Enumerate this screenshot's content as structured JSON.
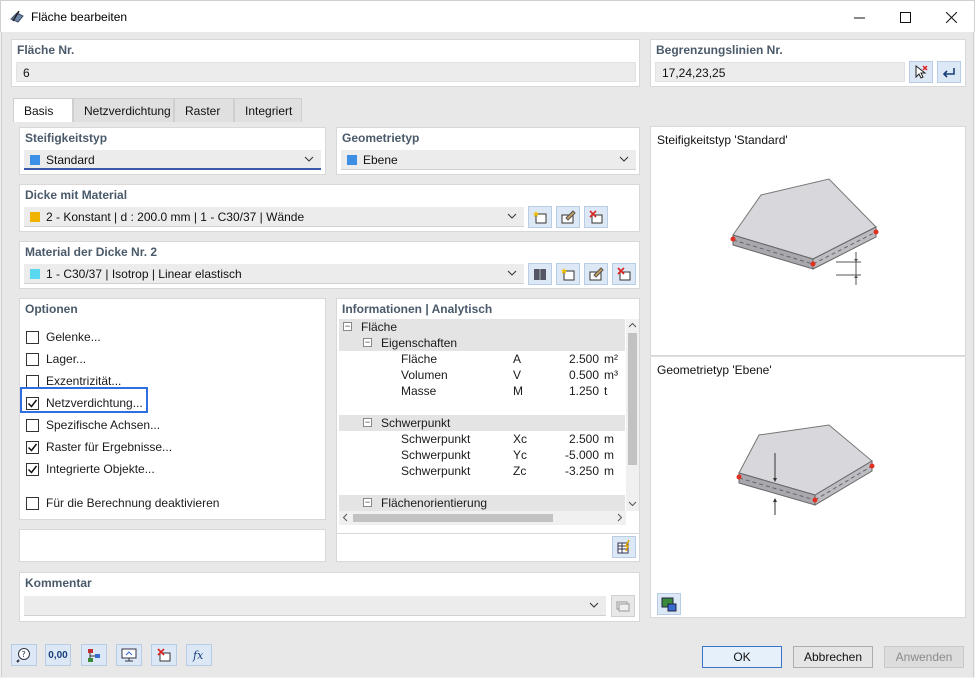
{
  "window": {
    "title": "Fläche bearbeiten"
  },
  "surface_no": {
    "label": "Fläche Nr.",
    "value": "6"
  },
  "boundary_lines": {
    "label": "Begrenzungslinien Nr.",
    "value": "17,24,23,25"
  },
  "tabs": [
    {
      "label": "Basis"
    },
    {
      "label": "Netzverdichtung"
    },
    {
      "label": "Raster"
    },
    {
      "label": "Integriert"
    }
  ],
  "stiffness": {
    "label": "Steifigkeitstyp",
    "value": "Standard",
    "swatch": "#3c8ee6"
  },
  "geometry": {
    "label": "Geometrietyp",
    "value": "Ebene",
    "swatch": "#3c8ee6"
  },
  "thickness": {
    "label": "Dicke mit Material",
    "value": "2 - Konstant | d : 200.0 mm | 1 - C30/37 | Wände",
    "swatch": "#f0b400"
  },
  "material": {
    "label": "Material der Dicke Nr. 2",
    "value": "1 - C30/37 | Isotrop | Linear elastisch",
    "swatch": "#5ad8f0"
  },
  "options": {
    "label": "Optionen",
    "items": [
      {
        "label": "Gelenke...",
        "checked": false
      },
      {
        "label": "Lager...",
        "checked": false
      },
      {
        "label": "Exzentrizität...",
        "checked": false
      },
      {
        "label": "Netzverdichtung...",
        "checked": true
      },
      {
        "label": "Spezifische Achsen...",
        "checked": false
      },
      {
        "label": "Raster für Ergebnisse...",
        "checked": true
      },
      {
        "label": "Integrierte Objekte...",
        "checked": true
      }
    ],
    "deactivate": {
      "label": "Für die Berechnung deaktivieren",
      "checked": false
    }
  },
  "info": {
    "label": "Informationen | Analytisch",
    "root": "Fläche",
    "groups": [
      {
        "name": "Eigenschaften",
        "rows": [
          {
            "name": "Fläche",
            "symbol": "A",
            "value": "2.500",
            "unit": "m²"
          },
          {
            "name": "Volumen",
            "symbol": "V",
            "value": "0.500",
            "unit": "m³"
          },
          {
            "name": "Masse",
            "symbol": "M",
            "value": "1.250",
            "unit": "t"
          }
        ]
      },
      {
        "name": "Schwerpunkt",
        "rows": [
          {
            "name": "Schwerpunkt",
            "symbol": "Xc",
            "value": "2.500",
            "unit": "m"
          },
          {
            "name": "Schwerpunkt",
            "symbol": "Yc",
            "value": "-5.000",
            "unit": "m"
          },
          {
            "name": "Schwerpunkt",
            "symbol": "Zc",
            "value": "-3.250",
            "unit": "m"
          }
        ]
      },
      {
        "name": "Flächenorientierung",
        "rows": []
      }
    ]
  },
  "preview_stiffness": {
    "label": "Steifigkeitstyp 'Standard'"
  },
  "preview_geometry": {
    "label": "Geometrietyp 'Ebene'"
  },
  "comment": {
    "label": "Kommentar",
    "value": ""
  },
  "buttons": {
    "ok": "OK",
    "cancel": "Abbrechen",
    "apply": "Anwenden"
  },
  "bottom_tools": {
    "units": "0,00"
  }
}
